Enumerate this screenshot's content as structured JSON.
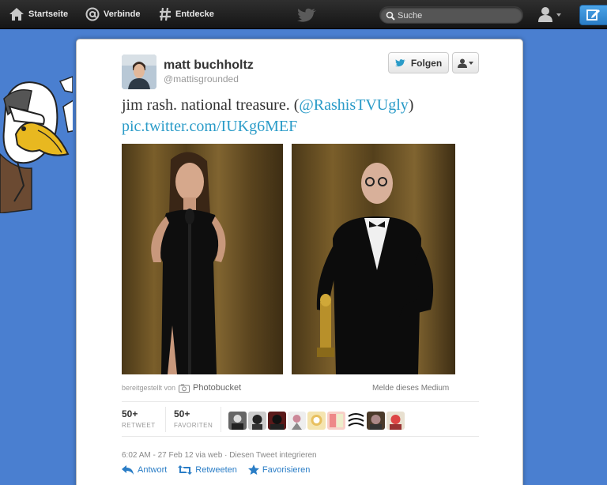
{
  "nav": {
    "home": "Startseite",
    "connect": "Verbinde",
    "discover": "Entdecke"
  },
  "search": {
    "placeholder": "Suche"
  },
  "tweet": {
    "fullname": "matt buchholtz",
    "username": "@mattisgrounded",
    "follow_label": "Folgen",
    "text_prefix": "jim rash. national treasure. (",
    "mention": "@RashisTVUgly",
    "text_suffix": ")",
    "pic_link": "pic.twitter.com/IUKg6MEF",
    "provider_prefix": "bereitgestellt von",
    "provider_name": "Photobucket",
    "report_label": "Melde dieses Medium",
    "retweet_count": "50+",
    "retweet_label": "RETWEET",
    "favorite_count": "50+",
    "favorite_label": "FAVORITEN",
    "timestamp": "6:02 AM - 27 Feb 12 via web",
    "embed_link": "Diesen Tweet integrieren",
    "reply_label": "Antwort",
    "retweet_action": "Retweeten",
    "favorite_action": "Favorisieren"
  },
  "colors": {
    "background": "#4a7fd0",
    "link": "#2a9bc8",
    "action": "#2a7dc6"
  },
  "icons": [
    "home-icon",
    "at-icon",
    "hash-icon",
    "bird-icon",
    "search-icon",
    "user-icon",
    "compose-icon",
    "camera-icon",
    "reply-icon",
    "retweet-icon",
    "star-icon"
  ]
}
